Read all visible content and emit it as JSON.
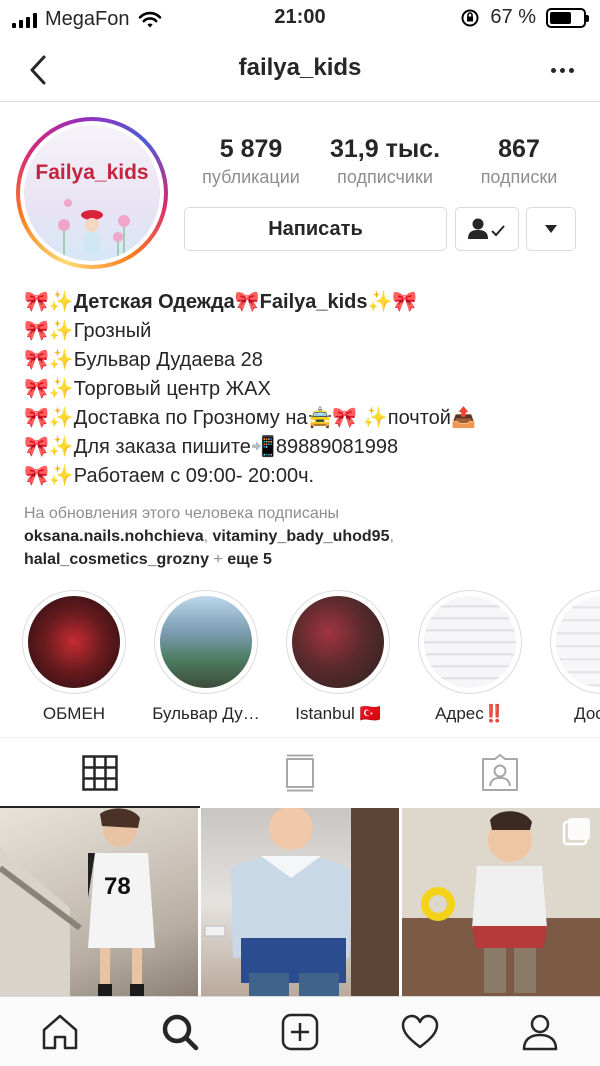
{
  "status_bar": {
    "carrier": "MegaFon",
    "time": "21:00",
    "battery_percent": "67 %",
    "battery_level": 0.67
  },
  "header": {
    "username": "failya_kids"
  },
  "avatar": {
    "text": "Failya_kids"
  },
  "stats": [
    {
      "value": "5 879",
      "label": "публикации"
    },
    {
      "value": "31,9 тыс.",
      "label": "подписчики"
    },
    {
      "value": "867",
      "label": "подписки"
    }
  ],
  "actions": {
    "message_label": "Написать"
  },
  "bio": {
    "name_line": "🎀✨Детская Одежда🎀Failya_kids✨🎀",
    "lines": [
      "🎀✨Грозный",
      "🎀✨Бульвар Дудаева 28",
      "🎀✨Торговый центр ЖАХ",
      "🎀✨Доставка по Грозному на🚖🎀 ✨почтой📤",
      "🎀✨Для заказа пишите📲89889081998",
      "🎀✨Работаем с 09:00- 20:00ч."
    ]
  },
  "followed_by": {
    "intro": "На обновления этого человека подписаны",
    "user1": "oksana.nails.nohchieva",
    "user2": "vitaminy_bady_uhod95",
    "user3": "halal_cosmetics_grozny",
    "plus": " + ",
    "more": "еще 5"
  },
  "highlights": [
    {
      "label": "ОБМЕН",
      "color": "#3a1418"
    },
    {
      "label": "Бульвар Ду…",
      "color": "#6d8fa6"
    },
    {
      "label": "Istanbul 🇹🇷",
      "color": "#4b3b36"
    },
    {
      "label": "Адрес‼️",
      "color": "#e9e7ee"
    },
    {
      "label": "Достав",
      "color": "#ecebef"
    }
  ],
  "icons": {
    "back": "chevron-left-icon",
    "more": "more-horizontal-icon",
    "grid": "grid-icon",
    "feed": "feed-icon",
    "tagged": "tagged-icon",
    "home": "home-icon",
    "search": "search-icon",
    "add": "add-icon",
    "heart": "heart-icon",
    "profile": "profile-icon"
  }
}
